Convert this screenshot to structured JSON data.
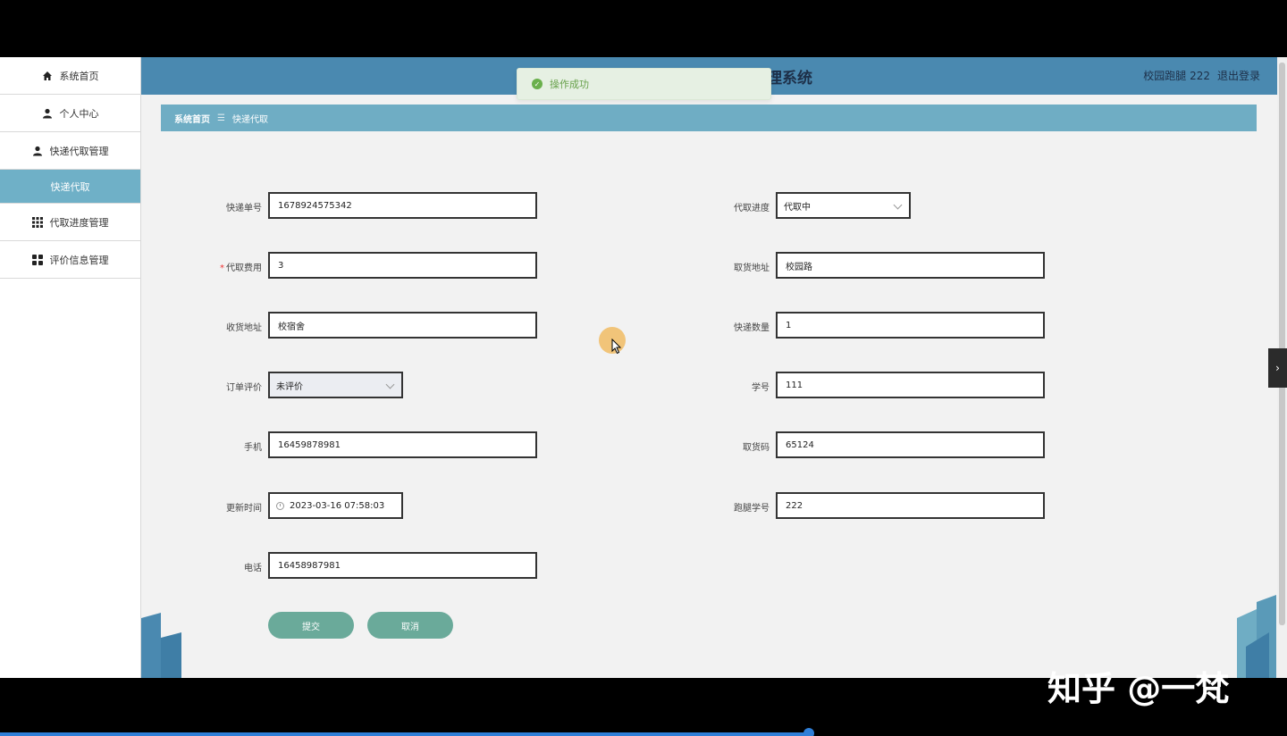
{
  "header": {
    "title": "理系统",
    "user_name": "校园跑腿 222",
    "logout": "退出登录"
  },
  "toast": {
    "message": "操作成功"
  },
  "sidebar": {
    "items": [
      {
        "label": "系统首页",
        "icon": "home-icon"
      },
      {
        "label": "个人中心",
        "icon": "user-icon"
      },
      {
        "label": "快递代取管理",
        "icon": "user-icon"
      },
      {
        "label": "快递代取",
        "icon": ""
      },
      {
        "label": "代取进度管理",
        "icon": "grid-icon"
      },
      {
        "label": "评价信息管理",
        "icon": "apps-icon"
      }
    ]
  },
  "breadcrumb": {
    "home": "系统首页",
    "separator": "☰",
    "current": "快递代取"
  },
  "form": {
    "left": [
      {
        "label": "快递单号",
        "value": "1678924575342"
      },
      {
        "label": "代取费用",
        "value": "3",
        "required": "*"
      },
      {
        "label": "收货地址",
        "value": "校宿舍"
      },
      {
        "label": "订单评价",
        "value": "未评价"
      },
      {
        "label": "手机",
        "value": "16459878981"
      },
      {
        "label": "更新时间",
        "value": "2023-03-16 07:58:03"
      },
      {
        "label": "电话",
        "value": "16458987981"
      }
    ],
    "right": [
      {
        "label": "代取进度",
        "value": "代取中"
      },
      {
        "label": "取货地址",
        "value": "校园路"
      },
      {
        "label": "快递数量",
        "value": "1"
      },
      {
        "label": "学号",
        "value": "111"
      },
      {
        "label": "取货码",
        "value": "65124"
      },
      {
        "label": "跑腿学号",
        "value": "222"
      }
    ],
    "submit": "提交",
    "cancel": "取消"
  },
  "watermark": "知乎 @一梵",
  "colors": {
    "header": "#4a89b0",
    "breadcrumb": "#6fadc4",
    "sidebar_active": "#6fb0c7",
    "button": "#6aaa9a",
    "toast_bg": "#e6f0e3"
  }
}
